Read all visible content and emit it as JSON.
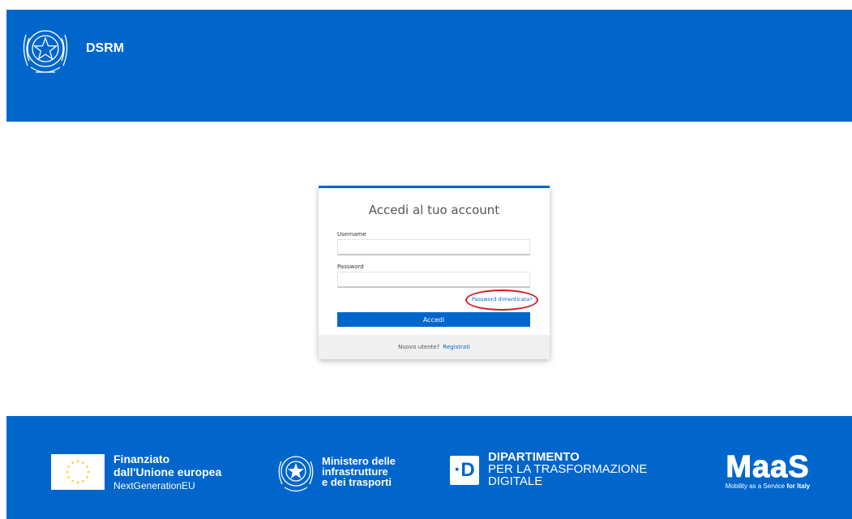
{
  "header": {
    "app_title": "DSRM"
  },
  "login": {
    "title": "Accedi al tuo account",
    "username_label": "Username",
    "username_value": "",
    "password_label": "Password",
    "password_value": "",
    "forgot_password": "Password dimenticata?",
    "submit_label": "Accedi",
    "new_user_prompt": "Nuovo utente?",
    "register_link": "Registrati"
  },
  "footer": {
    "eu": {
      "line1": "Finanziato",
      "line2": "dall'Unione europea",
      "line3": "NextGenerationEU"
    },
    "mit": {
      "line1": "Ministero delle",
      "line2": "infrastrutture",
      "line3": "e dei trasporti"
    },
    "dtd": {
      "badge": "·D",
      "line1": "DIPARTIMENTO",
      "line2": "PER LA TRASFORMAZIONE",
      "line3": "DIGITALE"
    },
    "maas": {
      "wordmark": "MaaS",
      "tagline_prefix": "Mobility as a Service",
      "tagline_bold": "for Italy"
    }
  },
  "colors": {
    "brand_blue": "#0066cc",
    "highlight_red": "#d0201f",
    "footer_card": "#f0f0f0"
  },
  "icons": [
    "italian-republic-emblem-icon",
    "eu-flag-icon",
    "mit-emblem-icon",
    "dtd-logo-icon",
    "maas-logo-icon"
  ]
}
